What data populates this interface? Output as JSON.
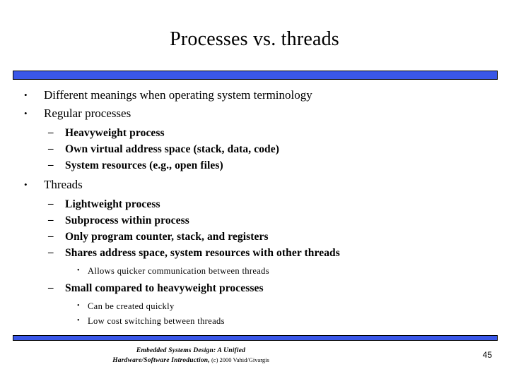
{
  "slide": {
    "title": "Processes vs. threads",
    "page_number": "45",
    "accent_color": "#3A57E8",
    "background_color": "#FFFFFF",
    "text_color": "#000000"
  },
  "decor": {
    "top_rule_name": "top-accent-bar",
    "bottom_rule_name": "bottom-accent-bar"
  },
  "markers": {
    "bullet_dot": "•",
    "bullet_dash": "–"
  },
  "outline": [
    {
      "level": 1,
      "text": "Different meanings when operating system terminology"
    },
    {
      "level": 1,
      "text": "Regular processes"
    },
    {
      "level": 2,
      "text": "Heavyweight process"
    },
    {
      "level": 2,
      "text": "Own virtual address space (stack, data, code)"
    },
    {
      "level": 2,
      "text": "System resources (e.g., open files)"
    },
    {
      "level": 1,
      "text": "Threads"
    },
    {
      "level": 2,
      "text": "Lightweight process"
    },
    {
      "level": 2,
      "text": "Subprocess within process"
    },
    {
      "level": 2,
      "text": "Only program counter, stack, and registers"
    },
    {
      "level": 2,
      "text": "Shares address space, system resources with other threads"
    },
    {
      "level": 3,
      "text": "Allows quicker communication between threads"
    },
    {
      "level": 2,
      "text": "Small compared to heavyweight processes"
    },
    {
      "level": 3,
      "text": "Can be created quickly"
    },
    {
      "level": 3,
      "text": "Low cost switching between threads"
    }
  ],
  "footer": {
    "book_title_line1": "Embedded Systems Design: A Unified",
    "book_title_line2": "Hardware/Software Introduction,",
    "copyright": "(c) 2000 Vahid/Givargis"
  }
}
